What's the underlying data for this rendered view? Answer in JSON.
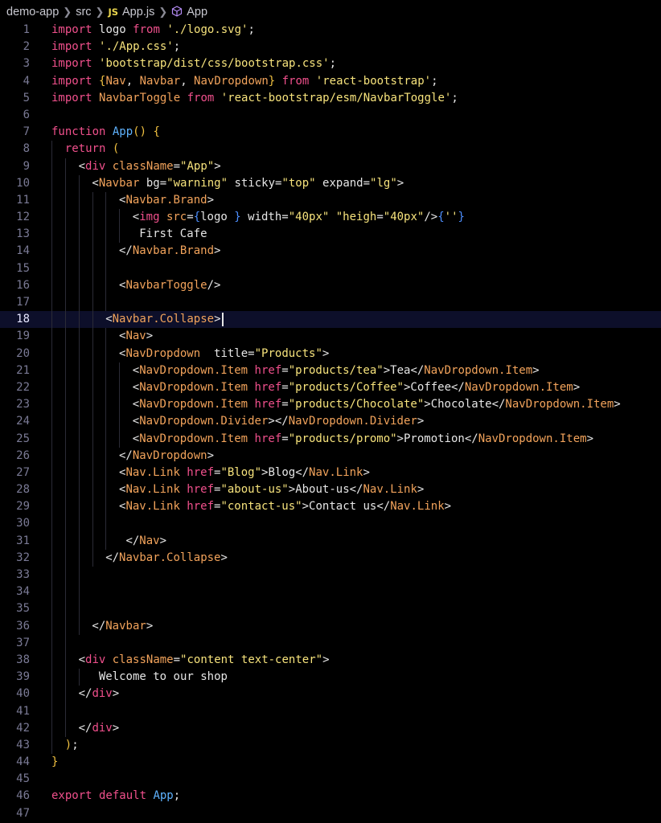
{
  "breadcrumb": {
    "project": "demo-app",
    "folder": "src",
    "file_badge": "JS",
    "file": "App.js",
    "symbol": "App"
  },
  "colors": {
    "keyword": "#f0508c",
    "string": "#f7e37c",
    "function": "#5fb3ff",
    "tag": "#f2a35b",
    "background": "#000000",
    "active_line": "#0d0f2a"
  },
  "editor": {
    "active_line": 18,
    "lines": [
      {
        "n": "1",
        "indent": 0,
        "t": [
          [
            "kw",
            "import "
          ],
          [
            "txt",
            "logo "
          ],
          [
            "kw",
            "from "
          ],
          [
            "str",
            "'./logo.svg'"
          ],
          [
            "punc",
            ";"
          ]
        ]
      },
      {
        "n": "2",
        "indent": 0,
        "t": [
          [
            "kw",
            "import "
          ],
          [
            "str",
            "'./App.css'"
          ],
          [
            "punc",
            ";"
          ]
        ]
      },
      {
        "n": "3",
        "indent": 0,
        "t": [
          [
            "kw",
            "import "
          ],
          [
            "str",
            "'bootstrap/dist/css/bootstrap.css'"
          ],
          [
            "punc",
            ";"
          ]
        ]
      },
      {
        "n": "4",
        "indent": 0,
        "t": [
          [
            "kw",
            "import "
          ],
          [
            "br",
            "{"
          ],
          [
            "tag",
            "Nav"
          ],
          [
            "punc",
            ", "
          ],
          [
            "tag",
            "Navbar"
          ],
          [
            "punc",
            ", "
          ],
          [
            "tag",
            "NavDropdown"
          ],
          [
            "br",
            "} "
          ],
          [
            "kw",
            "from "
          ],
          [
            "str",
            "'react-bootstrap'"
          ],
          [
            "punc",
            ";"
          ]
        ]
      },
      {
        "n": "5",
        "indent": 0,
        "t": [
          [
            "kw",
            "import "
          ],
          [
            "tag",
            "NavbarToggle "
          ],
          [
            "kw",
            "from "
          ],
          [
            "str",
            "'react-bootstrap/esm/NavbarToggle'"
          ],
          [
            "punc",
            ";"
          ]
        ]
      },
      {
        "n": "6",
        "indent": 0,
        "t": []
      },
      {
        "n": "7",
        "indent": 0,
        "t": [
          [
            "kw",
            "function "
          ],
          [
            "fn",
            "App"
          ],
          [
            "br",
            "() {"
          ]
        ]
      },
      {
        "n": "8",
        "indent": 1,
        "t": [
          [
            "kw",
            "return "
          ],
          [
            "br",
            "("
          ]
        ]
      },
      {
        "n": "9",
        "indent": 2,
        "t": [
          [
            "punc",
            "<"
          ],
          [
            "kw",
            "div "
          ],
          [
            "tag",
            "className"
          ],
          [
            "punc",
            "="
          ],
          [
            "str",
            "\"App\""
          ],
          [
            "punc",
            ">"
          ]
        ]
      },
      {
        "n": "10",
        "indent": 3,
        "t": [
          [
            "punc",
            "<"
          ],
          [
            "tag",
            "Navbar "
          ],
          [
            "txt",
            "bg"
          ],
          [
            "punc",
            "="
          ],
          [
            "str",
            "\"warning\" "
          ],
          [
            "txt",
            "sticky"
          ],
          [
            "punc",
            "="
          ],
          [
            "str",
            "\"top\" "
          ],
          [
            "txt",
            "expand"
          ],
          [
            "punc",
            "="
          ],
          [
            "str",
            "\"lg\""
          ],
          [
            "punc",
            ">"
          ]
        ]
      },
      {
        "n": "11",
        "indent": 5,
        "t": [
          [
            "punc",
            "<"
          ],
          [
            "tag",
            "Navbar.Brand"
          ],
          [
            "punc",
            ">"
          ]
        ]
      },
      {
        "n": "12",
        "indent": 6,
        "t": [
          [
            "punc",
            "<"
          ],
          [
            "kw",
            "img "
          ],
          [
            "tag",
            "src"
          ],
          [
            "punc",
            "="
          ],
          [
            "brace",
            "{"
          ],
          [
            "txt",
            "logo "
          ],
          [
            "brace",
            "} "
          ],
          [
            "txt",
            "width"
          ],
          [
            "punc",
            "="
          ],
          [
            "str",
            "\"40px\" "
          ],
          [
            "str",
            "\"heigh"
          ],
          [
            "punc",
            "="
          ],
          [
            "str",
            "\"40px\""
          ],
          [
            "punc",
            "/>"
          ],
          [
            "brace",
            "{"
          ],
          [
            "str",
            "''"
          ],
          [
            "brace",
            "}"
          ]
        ]
      },
      {
        "n": "13",
        "indent": 6,
        "t": [
          [
            "txt",
            " First Cafe"
          ]
        ]
      },
      {
        "n": "14",
        "indent": 5,
        "t": [
          [
            "punc",
            "</"
          ],
          [
            "tag",
            "Navbar.Brand"
          ],
          [
            "punc",
            ">"
          ]
        ]
      },
      {
        "n": "15",
        "indent": 5,
        "t": []
      },
      {
        "n": "16",
        "indent": 5,
        "t": [
          [
            "punc",
            "<"
          ],
          [
            "tag",
            "NavbarToggle"
          ],
          [
            "punc",
            "/>"
          ]
        ]
      },
      {
        "n": "17",
        "indent": 5,
        "t": []
      },
      {
        "n": "18",
        "indent": 4,
        "cursor": true,
        "t": [
          [
            "punc",
            "<"
          ],
          [
            "tag",
            "Navbar.Collapse"
          ],
          [
            "punc",
            ">"
          ]
        ]
      },
      {
        "n": "19",
        "indent": 5,
        "t": [
          [
            "punc",
            "<"
          ],
          [
            "tag",
            "Nav"
          ],
          [
            "punc",
            ">"
          ]
        ]
      },
      {
        "n": "20",
        "indent": 5,
        "t": [
          [
            "punc",
            "<"
          ],
          [
            "tag",
            "NavDropdown  "
          ],
          [
            "txt",
            "title"
          ],
          [
            "punc",
            "="
          ],
          [
            "str",
            "\"Products\""
          ],
          [
            "punc",
            ">"
          ]
        ]
      },
      {
        "n": "21",
        "indent": 6,
        "t": [
          [
            "punc",
            "<"
          ],
          [
            "tag",
            "NavDropdown.Item "
          ],
          [
            "attr",
            "href"
          ],
          [
            "punc",
            "="
          ],
          [
            "str",
            "\"products/tea\""
          ],
          [
            "punc",
            ">"
          ],
          [
            "txt",
            "Tea"
          ],
          [
            "punc",
            "</"
          ],
          [
            "tag",
            "NavDropdown.Item"
          ],
          [
            "punc",
            ">"
          ]
        ]
      },
      {
        "n": "22",
        "indent": 6,
        "t": [
          [
            "punc",
            "<"
          ],
          [
            "tag",
            "NavDropdown.Item "
          ],
          [
            "attr",
            "href"
          ],
          [
            "punc",
            "="
          ],
          [
            "str",
            "\"products/Coffee\""
          ],
          [
            "punc",
            ">"
          ],
          [
            "txt",
            "Coffee"
          ],
          [
            "punc",
            "</"
          ],
          [
            "tag",
            "NavDropdown.Item"
          ],
          [
            "punc",
            ">"
          ]
        ]
      },
      {
        "n": "23",
        "indent": 6,
        "t": [
          [
            "punc",
            "<"
          ],
          [
            "tag",
            "NavDropdown.Item "
          ],
          [
            "attr",
            "href"
          ],
          [
            "punc",
            "="
          ],
          [
            "str",
            "\"products/Chocolate\""
          ],
          [
            "punc",
            ">"
          ],
          [
            "txt",
            "Chocolate"
          ],
          [
            "punc",
            "</"
          ],
          [
            "tag",
            "NavDropdown.Item"
          ],
          [
            "punc",
            ">"
          ]
        ]
      },
      {
        "n": "24",
        "indent": 6,
        "t": [
          [
            "punc",
            "<"
          ],
          [
            "tag",
            "NavDropdown.Divider"
          ],
          [
            "punc",
            "></"
          ],
          [
            "tag",
            "NavDropdown.Divider"
          ],
          [
            "punc",
            ">"
          ]
        ]
      },
      {
        "n": "25",
        "indent": 6,
        "t": [
          [
            "punc",
            "<"
          ],
          [
            "tag",
            "NavDropdown.Item "
          ],
          [
            "attr",
            "href"
          ],
          [
            "punc",
            "="
          ],
          [
            "str",
            "\"products/promo\""
          ],
          [
            "punc",
            ">"
          ],
          [
            "txt",
            "Promotion"
          ],
          [
            "punc",
            "</"
          ],
          [
            "tag",
            "NavDropdown.Item"
          ],
          [
            "punc",
            ">"
          ]
        ]
      },
      {
        "n": "26",
        "indent": 5,
        "t": [
          [
            "punc",
            "</"
          ],
          [
            "tag",
            "NavDropdown"
          ],
          [
            "punc",
            ">"
          ]
        ]
      },
      {
        "n": "27",
        "indent": 5,
        "t": [
          [
            "punc",
            "<"
          ],
          [
            "tag",
            "Nav.Link "
          ],
          [
            "attr",
            "href"
          ],
          [
            "punc",
            "="
          ],
          [
            "str",
            "\"Blog\""
          ],
          [
            "punc",
            ">"
          ],
          [
            "txt",
            "Blog"
          ],
          [
            "punc",
            "</"
          ],
          [
            "tag",
            "Nav.Link"
          ],
          [
            "punc",
            ">"
          ]
        ]
      },
      {
        "n": "28",
        "indent": 5,
        "t": [
          [
            "punc",
            "<"
          ],
          [
            "tag",
            "Nav.Link "
          ],
          [
            "attr",
            "href"
          ],
          [
            "punc",
            "="
          ],
          [
            "str",
            "\"about-us\""
          ],
          [
            "punc",
            ">"
          ],
          [
            "txt",
            "About-us"
          ],
          [
            "punc",
            "</"
          ],
          [
            "tag",
            "Nav.Link"
          ],
          [
            "punc",
            ">"
          ]
        ]
      },
      {
        "n": "29",
        "indent": 5,
        "t": [
          [
            "punc",
            "<"
          ],
          [
            "tag",
            "Nav.Link "
          ],
          [
            "attr",
            "href"
          ],
          [
            "punc",
            "="
          ],
          [
            "str",
            "\"contact-us\""
          ],
          [
            "punc",
            ">"
          ],
          [
            "txt",
            "Contact us"
          ],
          [
            "punc",
            "</"
          ],
          [
            "tag",
            "Nav.Link"
          ],
          [
            "punc",
            ">"
          ]
        ]
      },
      {
        "n": "30",
        "indent": 5,
        "t": []
      },
      {
        "n": "31",
        "indent": 5,
        "t": [
          [
            "txt",
            " "
          ],
          [
            "punc",
            "</"
          ],
          [
            "tag",
            "Nav"
          ],
          [
            "punc",
            ">"
          ]
        ]
      },
      {
        "n": "32",
        "indent": 4,
        "t": [
          [
            "punc",
            "</"
          ],
          [
            "tag",
            "Navbar.Collapse"
          ],
          [
            "punc",
            ">"
          ]
        ]
      },
      {
        "n": "33",
        "indent": 3,
        "t": []
      },
      {
        "n": "34",
        "indent": 3,
        "t": []
      },
      {
        "n": "35",
        "indent": 3,
        "t": []
      },
      {
        "n": "36",
        "indent": 3,
        "t": [
          [
            "punc",
            "</"
          ],
          [
            "tag",
            "Navbar"
          ],
          [
            "punc",
            ">"
          ]
        ]
      },
      {
        "n": "37",
        "indent": 2,
        "t": []
      },
      {
        "n": "38",
        "indent": 2,
        "t": [
          [
            "punc",
            "<"
          ],
          [
            "kw",
            "div "
          ],
          [
            "tag",
            "className"
          ],
          [
            "punc",
            "="
          ],
          [
            "str",
            "\"content text-center\""
          ],
          [
            "punc",
            ">"
          ]
        ]
      },
      {
        "n": "39",
        "indent": 3,
        "t": [
          [
            "txt",
            " Welcome to our shop"
          ]
        ]
      },
      {
        "n": "40",
        "indent": 2,
        "t": [
          [
            "punc",
            "</"
          ],
          [
            "kw",
            "div"
          ],
          [
            "punc",
            ">"
          ]
        ]
      },
      {
        "n": "41",
        "indent": 2,
        "t": []
      },
      {
        "n": "42",
        "indent": 2,
        "t": [
          [
            "punc",
            "</"
          ],
          [
            "kw",
            "div"
          ],
          [
            "punc",
            ">"
          ]
        ]
      },
      {
        "n": "43",
        "indent": 1,
        "t": [
          [
            "br",
            ")"
          ],
          [
            "punc",
            ";"
          ]
        ]
      },
      {
        "n": "44",
        "indent": 0,
        "t": [
          [
            "br",
            "}"
          ]
        ]
      },
      {
        "n": "45",
        "indent": 0,
        "t": []
      },
      {
        "n": "46",
        "indent": 0,
        "t": [
          [
            "kw",
            "export default "
          ],
          [
            "fn",
            "App"
          ],
          [
            "punc",
            ";"
          ]
        ]
      },
      {
        "n": "47",
        "indent": 0,
        "t": []
      }
    ]
  }
}
